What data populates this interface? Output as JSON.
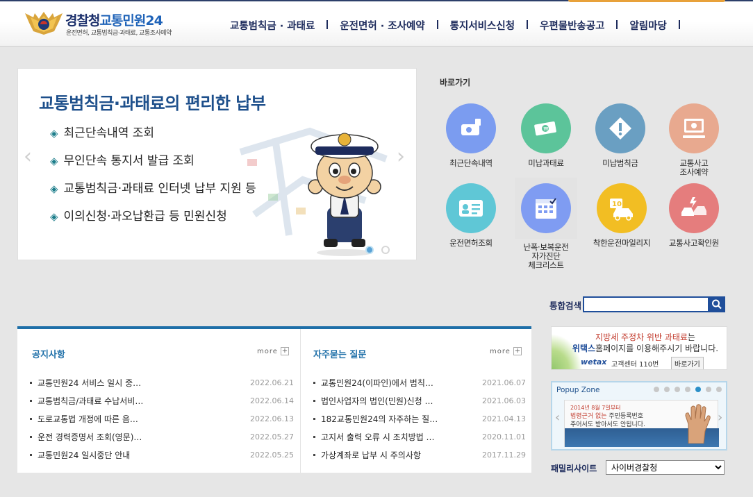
{
  "header": {
    "logo_title_part1": "경찰청",
    "logo_title_part2": "교통민원24",
    "logo_subtitle": "운전면허, 교통범칙금·과태료, 교통조사예약",
    "nav": [
      {
        "label": "교통범칙금 · 과태료"
      },
      {
        "label": "운전면허 · 조사예약"
      },
      {
        "label": "통지서비스신청"
      },
      {
        "label": "우편물반송공고"
      },
      {
        "label": "알림마당"
      }
    ]
  },
  "banner": {
    "title": "교통범칙금·과태료의 편리한 납부",
    "bullet": "◈",
    "items": [
      {
        "text": "최근단속내역 조회"
      },
      {
        "text": "무인단속 통지서 발급 조회"
      },
      {
        "text": "교통범칙금·과태료 인터넷 납부 지원 등"
      },
      {
        "text": "이의신청·과오납환급 등 민원신청"
      }
    ],
    "prev": "‹",
    "next": "›"
  },
  "quick": {
    "title": "바로가기",
    "items": [
      {
        "label": "최근단속내역",
        "color": "#7b9cf0",
        "icon": "camera-icon"
      },
      {
        "label": "미납과태료",
        "color": "#5cc49a",
        "icon": "money-icon"
      },
      {
        "label": "미납범칙금",
        "color": "#6a9fc2",
        "icon": "warning-icon"
      },
      {
        "label": "교통사고\n조사예약",
        "color": "#e8a98f",
        "icon": "computer-icon"
      },
      {
        "label": "운전면허조회",
        "color": "#5fc7d6",
        "icon": "license-icon"
      },
      {
        "label": "난폭·보복운전\n자가진단\n체크리스트",
        "color": "#7f9cf2",
        "icon": "calendar-icon"
      },
      {
        "label": "착한운전마일리지",
        "color": "#f2be23",
        "icon": "car-icon"
      },
      {
        "label": "교통사고확인원",
        "color": "#e57d7d",
        "icon": "accident-icon"
      }
    ]
  },
  "search": {
    "label": "통합검색",
    "value": ""
  },
  "notice": {
    "title": "공지사항",
    "more": "more",
    "rows": [
      {
        "title": "교통민원24 서비스 일시 중…",
        "date": "2022.06.21"
      },
      {
        "title": "교통범칙금/과태료 수납서비…",
        "date": "2022.06.14"
      },
      {
        "title": "도로교통법 개정에 따른 음…",
        "date": "2022.06.13"
      },
      {
        "title": "운전 경력증명서 조회(영문)…",
        "date": "2022.05.27"
      },
      {
        "title": "교통민원24 일시중단 안내",
        "date": "2022.05.25"
      }
    ]
  },
  "faq": {
    "title": "자주묻는 질문",
    "more": "more",
    "rows": [
      {
        "title": "교통민원24(이파인)에서 범칙…",
        "date": "2021.06.07"
      },
      {
        "title": "법인사업자의 법인(민원)신청 …",
        "date": "2021.06.03"
      },
      {
        "title": "182교통민원24의 자주하는 질…",
        "date": "2021.04.13"
      },
      {
        "title": "고지서 출력 오류 시 조치방법 …",
        "date": "2020.11.01"
      },
      {
        "title": "가상계좌로 납부 시 주의사항",
        "date": "2017.11.29"
      }
    ]
  },
  "ad": {
    "line1_red": "지방세 주정차 위반 과태료",
    "line1_rest": "는",
    "line2_bold": "위택스",
    "line2_rest": "홈페이지를 이용해주시기 바랍니다.",
    "brand": "wetax",
    "phone": "고객센터 110번",
    "shortcut": "바로가기"
  },
  "popup": {
    "title": "Popup Zone",
    "dot_count": 7,
    "active_dot": 5,
    "line1": "2014년 8월 7일부터",
    "line2_red": "법령근거 없는",
    "line2_rest": " 주민등록번호",
    "line3": "주어서도 받아서도 안됩니다.",
    "prev": "‹",
    "next": "›"
  },
  "family": {
    "label": "패밀리사이트",
    "selected": "사이버경찰청"
  }
}
